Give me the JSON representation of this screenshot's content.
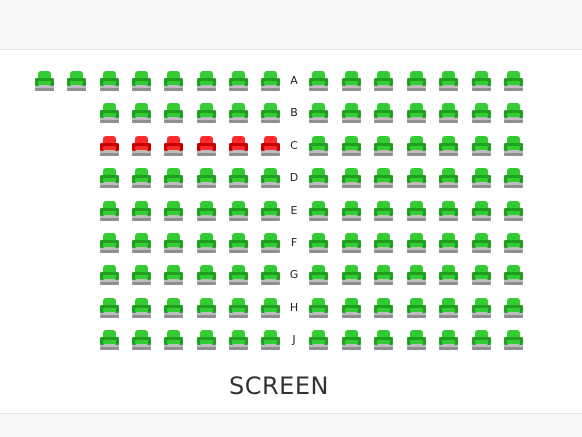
{
  "screen_label": "SCREEN",
  "colors": {
    "available_top": "#33cc33",
    "available_dark": "#1f9e1f",
    "selected_top": "#ff2a2a",
    "selected_dark": "#c40000",
    "seat_base": "#bdbdbd",
    "seat_base_dark": "#8f8f8f"
  },
  "icons": {
    "seat": "seat-icon"
  },
  "columns": {
    "left_block_max": 8,
    "right_block": 7
  },
  "rows": [
    {
      "label": "A",
      "left_seats": 8,
      "right_seats": 7,
      "selected_left": []
    },
    {
      "label": "B",
      "left_seats": 6,
      "right_seats": 7,
      "selected_left": []
    },
    {
      "label": "C",
      "left_seats": 6,
      "right_seats": 7,
      "selected_left": [
        1,
        2,
        3,
        4,
        5,
        6
      ]
    },
    {
      "label": "D",
      "left_seats": 6,
      "right_seats": 7,
      "selected_left": []
    },
    {
      "label": "E",
      "left_seats": 6,
      "right_seats": 7,
      "selected_left": []
    },
    {
      "label": "F",
      "left_seats": 6,
      "right_seats": 7,
      "selected_left": []
    },
    {
      "label": "G",
      "left_seats": 6,
      "right_seats": 7,
      "selected_left": []
    },
    {
      "label": "H",
      "left_seats": 6,
      "right_seats": 7,
      "selected_left": []
    },
    {
      "label": "J",
      "left_seats": 6,
      "right_seats": 7,
      "selected_left": []
    }
  ]
}
